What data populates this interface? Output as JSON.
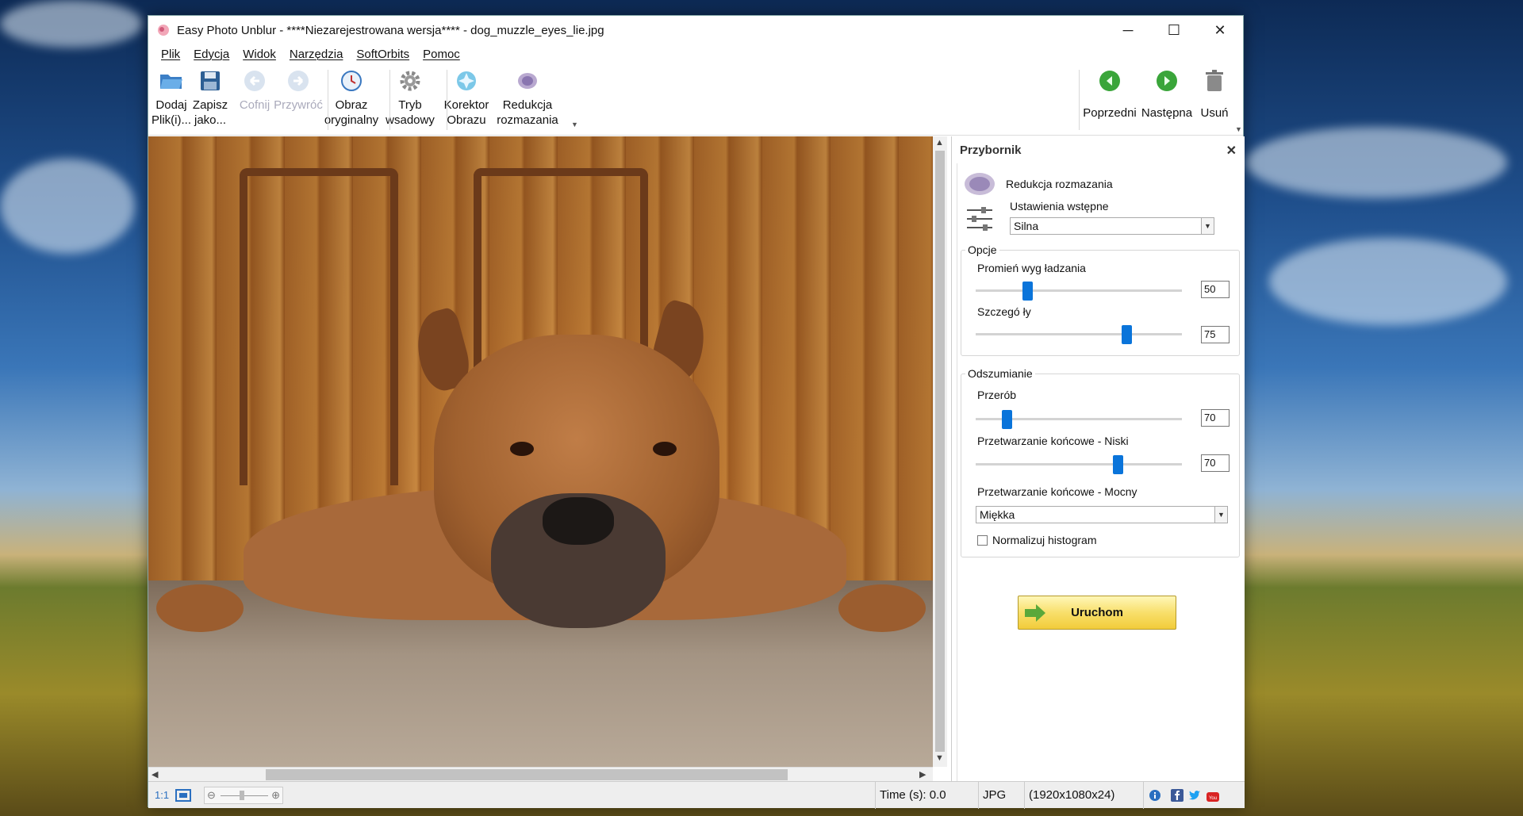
{
  "window": {
    "title": "Easy Photo Unblur - ****Niezarejestrowana wersja**** - dog_muzzle_eyes_lie.jpg",
    "controls": {
      "minimize": "─",
      "maximize": "☐",
      "close": "✕"
    }
  },
  "menu": [
    "Plik",
    "Edycja",
    "Widok",
    "Narzędzia",
    "SoftOrbits",
    "Pomoc"
  ],
  "toolbar": {
    "add_files": [
      "Dodaj",
      "Plik(i)..."
    ],
    "save_as": [
      "Zapisz",
      "jako..."
    ],
    "undo": "Cofnij",
    "redo": "Przywróć",
    "original": [
      "Obraz",
      "oryginalny"
    ],
    "batch": [
      "Tryb",
      "wsadowy"
    ],
    "corrector": [
      "Korektor",
      "Obrazu"
    ],
    "blur_reduction": [
      "Redukcja",
      "rozmazania"
    ],
    "previous": "Poprzedni",
    "next": "Następna",
    "delete": "Usuń"
  },
  "panel": {
    "title": "Przybornik",
    "tool_name": "Redukcja rozmazania",
    "presets_label": "Ustawienia wstępne",
    "presets_value": "Silna",
    "options_group": "Opcje",
    "smoothing_label": "Promień wyg ładzania",
    "smoothing_value": "50",
    "smoothing_level": 0.25,
    "details_label": "Szczegó ły",
    "details_value": "75",
    "details_level": 0.73,
    "denoise_group": "Odszumianie",
    "processing_label": "Przerób",
    "processing_value": "70",
    "processing_level": 0.15,
    "post_low_label": "Przetwarzanie końcowe - Niski",
    "post_low_value": "70",
    "post_low_level": 0.69,
    "post_strong_label": "Przetwarzanie końcowe - Mocny",
    "post_strong_value": "Miękka",
    "normalize_label": "Normalizuj histogram",
    "normalize_checked": false,
    "run_label": "Uruchom"
  },
  "status": {
    "zoom_label": "1:1",
    "time": "Time (s): 0.0",
    "format": "JPG",
    "dimensions": "(1920x1080x24)"
  },
  "colors": {
    "accent": "#0a74da",
    "run_button": "#f8df6b"
  }
}
